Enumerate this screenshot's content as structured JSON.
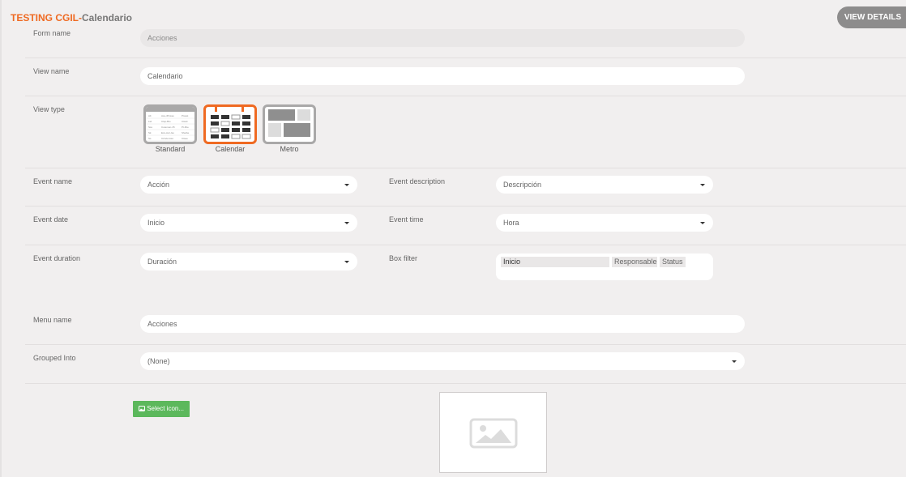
{
  "header": {
    "app_name": "TESTING CGIL",
    "separator": "-",
    "form_name": "Calendario",
    "view_details_label": "VIEW DETAILS"
  },
  "form": {
    "form_name": {
      "label": "Form name",
      "value": "Acciones"
    },
    "view_name": {
      "label": "View name",
      "value": "Calendario"
    },
    "view_type": {
      "label": "View type",
      "options": [
        {
          "label": "Standard",
          "selected": false
        },
        {
          "label": "Calendar",
          "selected": true
        },
        {
          "label": "Metro",
          "selected": false
        }
      ],
      "standard_preview_rows": [
        [
          "Alt",
          "Ass-45 Hau",
          "Ptosst"
        ],
        [
          "Ltd",
          "Ctsp-Bio",
          "Ctsnk"
        ],
        [
          "Sss",
          "Cotemen-15",
          "Pt-bhe"
        ],
        [
          "Sk",
          "Ecs-Avc-Iso",
          "Sheibe"
        ],
        [
          "Ss",
          "CtxVet-Ass",
          "Ctsee"
        ]
      ]
    },
    "event_name": {
      "label": "Event name",
      "value": "Acción"
    },
    "event_description": {
      "label": "Event description",
      "value": "Descripción"
    },
    "event_date": {
      "label": "Event date",
      "value": "Inicio"
    },
    "event_time": {
      "label": "Event time",
      "value": "Hora"
    },
    "event_duration": {
      "label": "Event duration",
      "value": "Duración"
    },
    "box_filter": {
      "label": "Box filter",
      "chips": [
        "Inicio",
        "Responsable",
        "Status"
      ]
    },
    "menu_name": {
      "label": "Menu name",
      "value": "Acciones"
    },
    "grouped_into": {
      "label": "Grouped Into",
      "value": "(None)"
    },
    "select_icon_label": "Select icon..."
  },
  "colors": {
    "accent": "#ef6a22",
    "button_green": "#5cb85c",
    "view_details_bg": "#8d8c8c"
  },
  "icons": {
    "select_icon_button": "image-icon",
    "icon_preview": "image-placeholder-icon"
  }
}
